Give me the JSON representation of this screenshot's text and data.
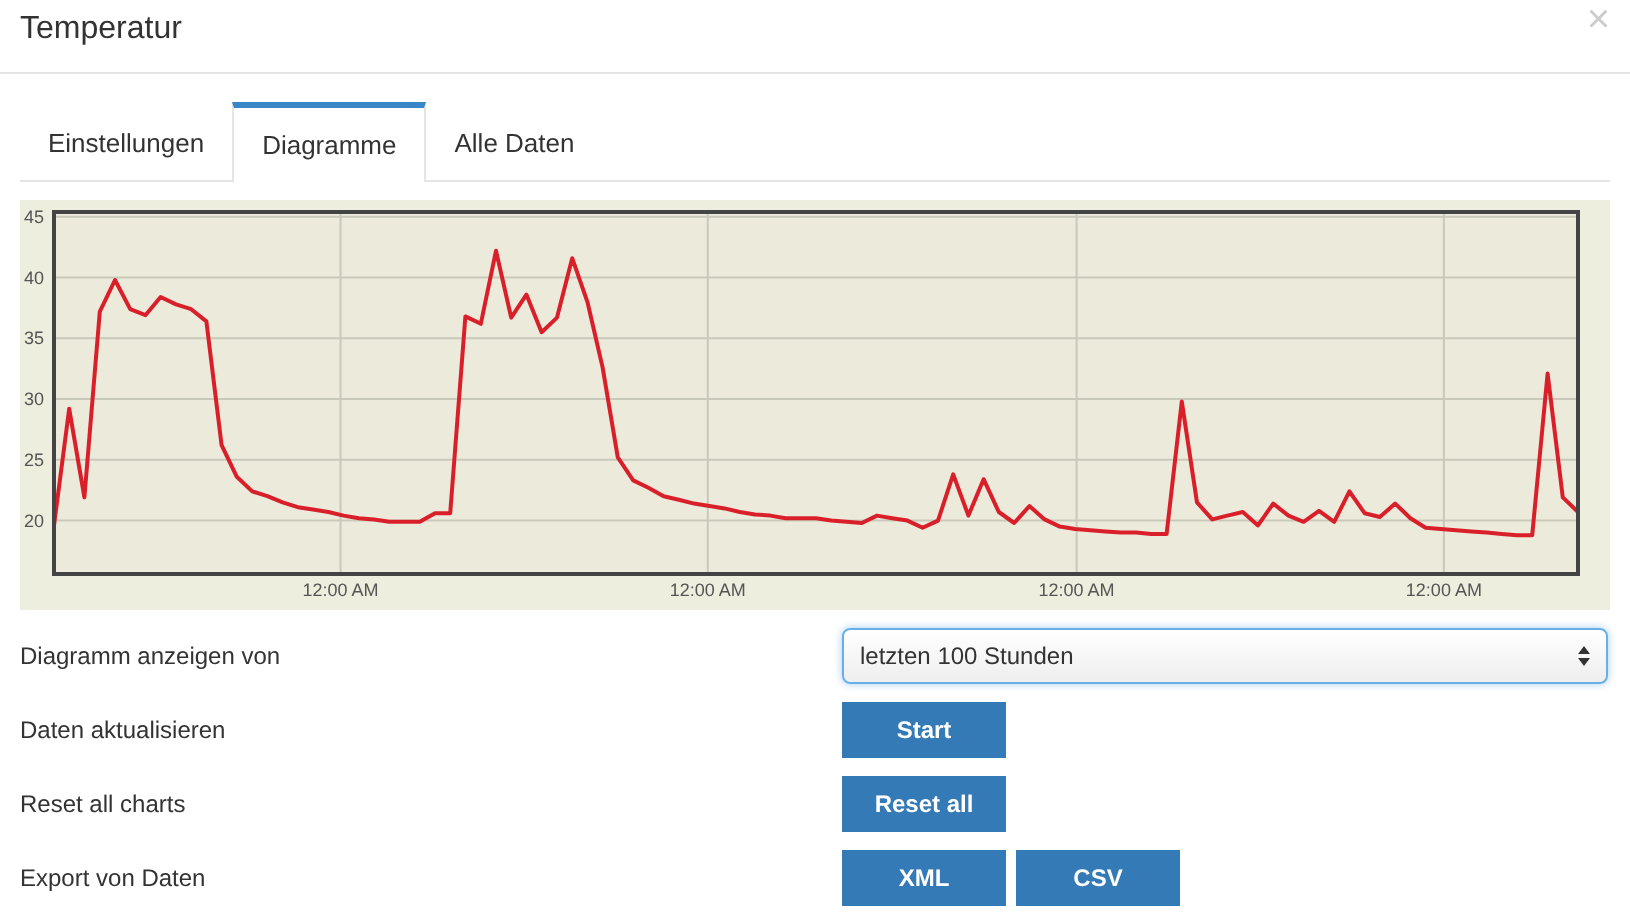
{
  "window": {
    "title": "Temperatur",
    "close": "×"
  },
  "tabs": [
    {
      "label": "Einstellungen",
      "selected": false
    },
    {
      "label": "Diagramme",
      "selected": true
    },
    {
      "label": "Alle Daten",
      "selected": false
    }
  ],
  "chart": {
    "chart_data": {
      "type": "line",
      "grid": true,
      "ylim": [
        15.6,
        45.4
      ],
      "yticks": [
        20,
        25,
        30,
        35,
        40,
        45
      ],
      "categories": [
        null,
        null,
        null,
        null,
        null,
        null,
        null,
        null,
        null,
        null,
        null,
        null,
        null,
        null,
        null,
        null,
        null,
        null,
        null,
        null,
        null,
        null,
        null,
        null,
        null,
        null,
        null,
        null,
        null,
        null,
        null,
        null,
        null,
        null,
        null,
        null,
        null,
        null,
        null,
        null,
        null,
        null,
        null,
        null,
        null,
        null,
        null,
        null,
        null,
        null,
        null,
        null,
        null,
        null,
        null,
        null,
        null,
        null,
        null,
        null,
        null,
        null,
        null,
        null,
        null,
        null,
        null,
        null,
        null,
        null,
        null,
        null,
        null,
        null,
        null,
        null,
        null,
        null,
        null,
        null,
        null,
        null,
        null,
        null,
        null,
        null,
        null,
        null,
        null,
        null,
        null,
        null,
        null,
        null,
        null,
        null,
        null,
        null,
        null,
        null,
        null
      ],
      "series": [
        {
          "color": "#d9202a",
          "values": [
            19.6,
            29.2,
            21.9,
            37.2,
            39.8,
            37.4,
            36.9,
            38.4,
            37.8,
            37.4,
            36.4,
            26.2,
            23.6,
            22.4,
            22.0,
            21.5,
            21.1,
            20.9,
            20.7,
            20.4,
            20.2,
            20.1,
            19.9,
            19.9,
            19.9,
            20.6,
            20.6,
            36.8,
            36.2,
            42.2,
            36.7,
            38.6,
            35.5,
            36.7,
            41.6,
            38.0,
            32.6,
            25.2,
            23.3,
            22.7,
            22.0,
            21.7,
            21.4,
            21.2,
            21.0,
            20.7,
            20.5,
            20.4,
            20.2,
            20.2,
            20.2,
            20.0,
            19.9,
            19.8,
            20.4,
            20.2,
            20.0,
            19.4,
            20.0,
            23.8,
            20.4,
            23.4,
            20.7,
            19.8,
            21.2,
            20.1,
            19.5,
            19.3,
            19.2,
            19.1,
            19.0,
            19.0,
            18.9,
            18.9,
            29.8,
            21.5,
            20.1,
            20.4,
            20.7,
            19.6,
            21.4,
            20.4,
            19.9,
            20.8,
            19.9,
            22.4,
            20.6,
            20.3,
            21.4,
            20.2,
            19.4,
            19.3,
            19.2,
            19.1,
            19.0,
            18.9,
            18.8,
            18.8,
            32.1,
            21.9,
            20.7
          ]
        }
      ]
    },
    "x_axis_labels": [
      "12:00 AM",
      "12:00 AM",
      "12:00 AM",
      "12:00 AM"
    ]
  },
  "form": [
    {
      "label": "Diagramm anzeigen von",
      "kind": "select",
      "value": "letzten 100 Stunden"
    },
    {
      "label": "Daten aktualisieren",
      "kind": "buttons",
      "buttons": [
        "Start"
      ]
    },
    {
      "label": "Reset all charts",
      "kind": "buttons",
      "buttons": [
        "Reset all"
      ]
    },
    {
      "label": "Export von Daten",
      "kind": "buttons",
      "buttons": [
        "XML",
        "CSV"
      ]
    }
  ]
}
